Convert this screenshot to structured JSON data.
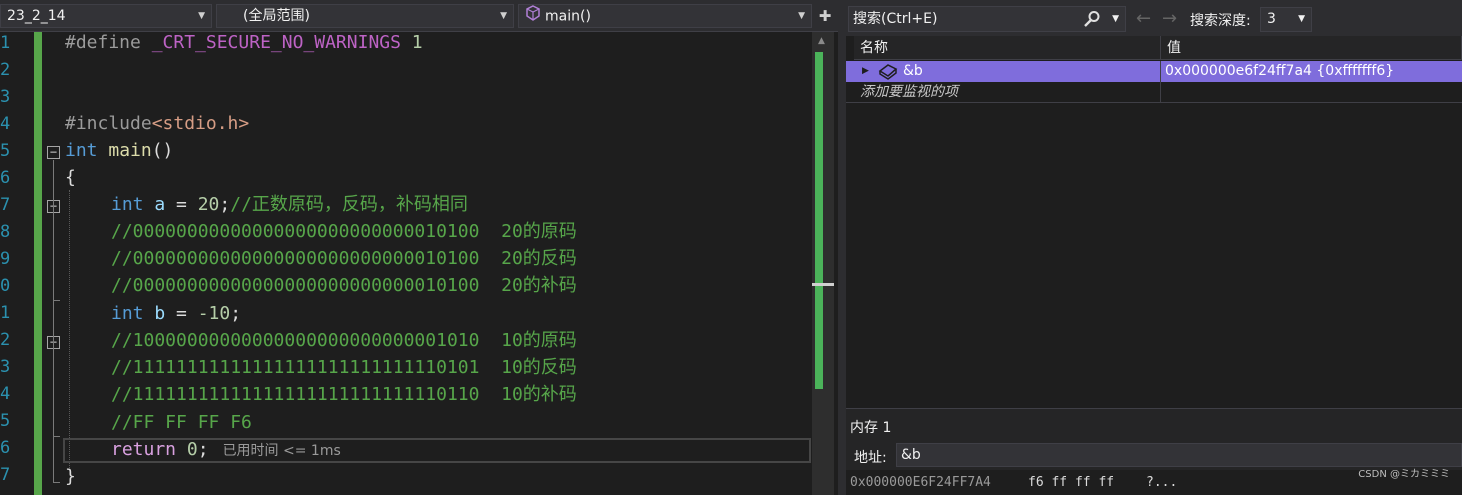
{
  "navbar": {
    "project": "23_2_14",
    "scope": "(全局范围)",
    "function": "main()"
  },
  "line_numbers": [
    "1",
    "2",
    "3",
    "4",
    "5",
    "6",
    "7",
    "8",
    "9",
    "0",
    "1",
    "2",
    "3",
    "4",
    "5",
    "6",
    "7"
  ],
  "code": {
    "l1": {
      "pp": "#define ",
      "macro": "_CRT_SECURE_NO_WARNINGS",
      "num": " 1"
    },
    "l4": {
      "pp": "#include",
      "str": "<stdio.h>"
    },
    "l5": {
      "kw": "int",
      "fn": " main",
      "rest": "()"
    },
    "l6": {
      "text": "{"
    },
    "l7": {
      "kw": "int",
      "id": " a",
      "op": " = ",
      "num": "20",
      "semi": ";",
      "cm": "//正数原码，反码，补码相同"
    },
    "l8": {
      "cm": "//00000000000000000000000000010100  20的原码"
    },
    "l9": {
      "cm": "//00000000000000000000000000010100  20的反码"
    },
    "l10": {
      "cm": "//00000000000000000000000000010100  20的补码"
    },
    "l11": {
      "kw": "int",
      "id": " b",
      "op": " = ",
      "num": "-10",
      "semi": ";"
    },
    "l12": {
      "cm": "//10000000000000000000000000001010  10的原码"
    },
    "l13": {
      "cm": "//11111111111111111111111111110101  10的反码"
    },
    "l14": {
      "cm": "//11111111111111111111111111110110  10的补码"
    },
    "l15": {
      "cm": "//FF FF FF F6"
    },
    "l16": {
      "kw": "return",
      "num": " 0",
      "semi": ";",
      "tip": "已用时间 <= 1ms"
    },
    "l17": {
      "text": "}"
    }
  },
  "watch": {
    "search_placeholder": "搜索(Ctrl+E)",
    "depth_label": "搜索深度:",
    "depth_value": "3",
    "col_name": "名称",
    "col_value": "值",
    "rows": [
      {
        "name": "&b",
        "value": "0x000000e6f24ff7a4 {0xfffffff6}"
      }
    ],
    "add_prompt": "添加要监视的项"
  },
  "memory": {
    "title": "内存 1",
    "address_label": "地址:",
    "address_value": "&b",
    "row_address": "0x000000E6F24FF7A4",
    "row_bytes": "f6 ff ff ff",
    "row_chars": "?..."
  },
  "watermark": "CSDN @ミカミミミ",
  "colors": {
    "accent_selection": "#7f6ddc",
    "change_bar": "#57a64a",
    "keyword": "#569cd6",
    "comment": "#57a64a"
  }
}
